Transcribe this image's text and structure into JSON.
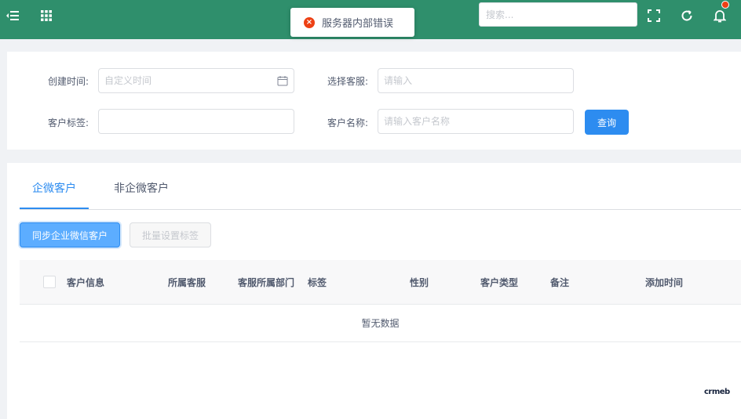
{
  "header": {
    "search_placeholder": "搜索...",
    "accent_color": "#2f8f6c",
    "icons": [
      "menu-toggle-icon",
      "apps-grid-icon",
      "fullscreen-icon",
      "refresh-icon",
      "bell-icon"
    ]
  },
  "toast": {
    "message": "服务器内部错误",
    "type": "error"
  },
  "filters": {
    "created_time_label": "创建时间:",
    "created_time_placeholder": "自定义时间",
    "agent_label": "选择客服:",
    "agent_placeholder": "请输入",
    "tag_label": "客户标签:",
    "tag_value": "",
    "name_label": "客户名称:",
    "name_placeholder": "请输入客户名称",
    "query_button": "查询"
  },
  "tabs": [
    {
      "label": "企微客户",
      "active": true
    },
    {
      "label": "非企微客户",
      "active": false
    }
  ],
  "actions": {
    "sync_button": "同步企业微信客户",
    "batch_tag_button": "批量设置标签"
  },
  "table": {
    "columns": [
      "客户信息",
      "所属客服",
      "客服所属部门",
      "标签",
      "性别",
      "客户类型",
      "备注",
      "添加时间"
    ],
    "empty_text": "暂无数据"
  },
  "footer": {
    "logo_text": "crmeb"
  }
}
